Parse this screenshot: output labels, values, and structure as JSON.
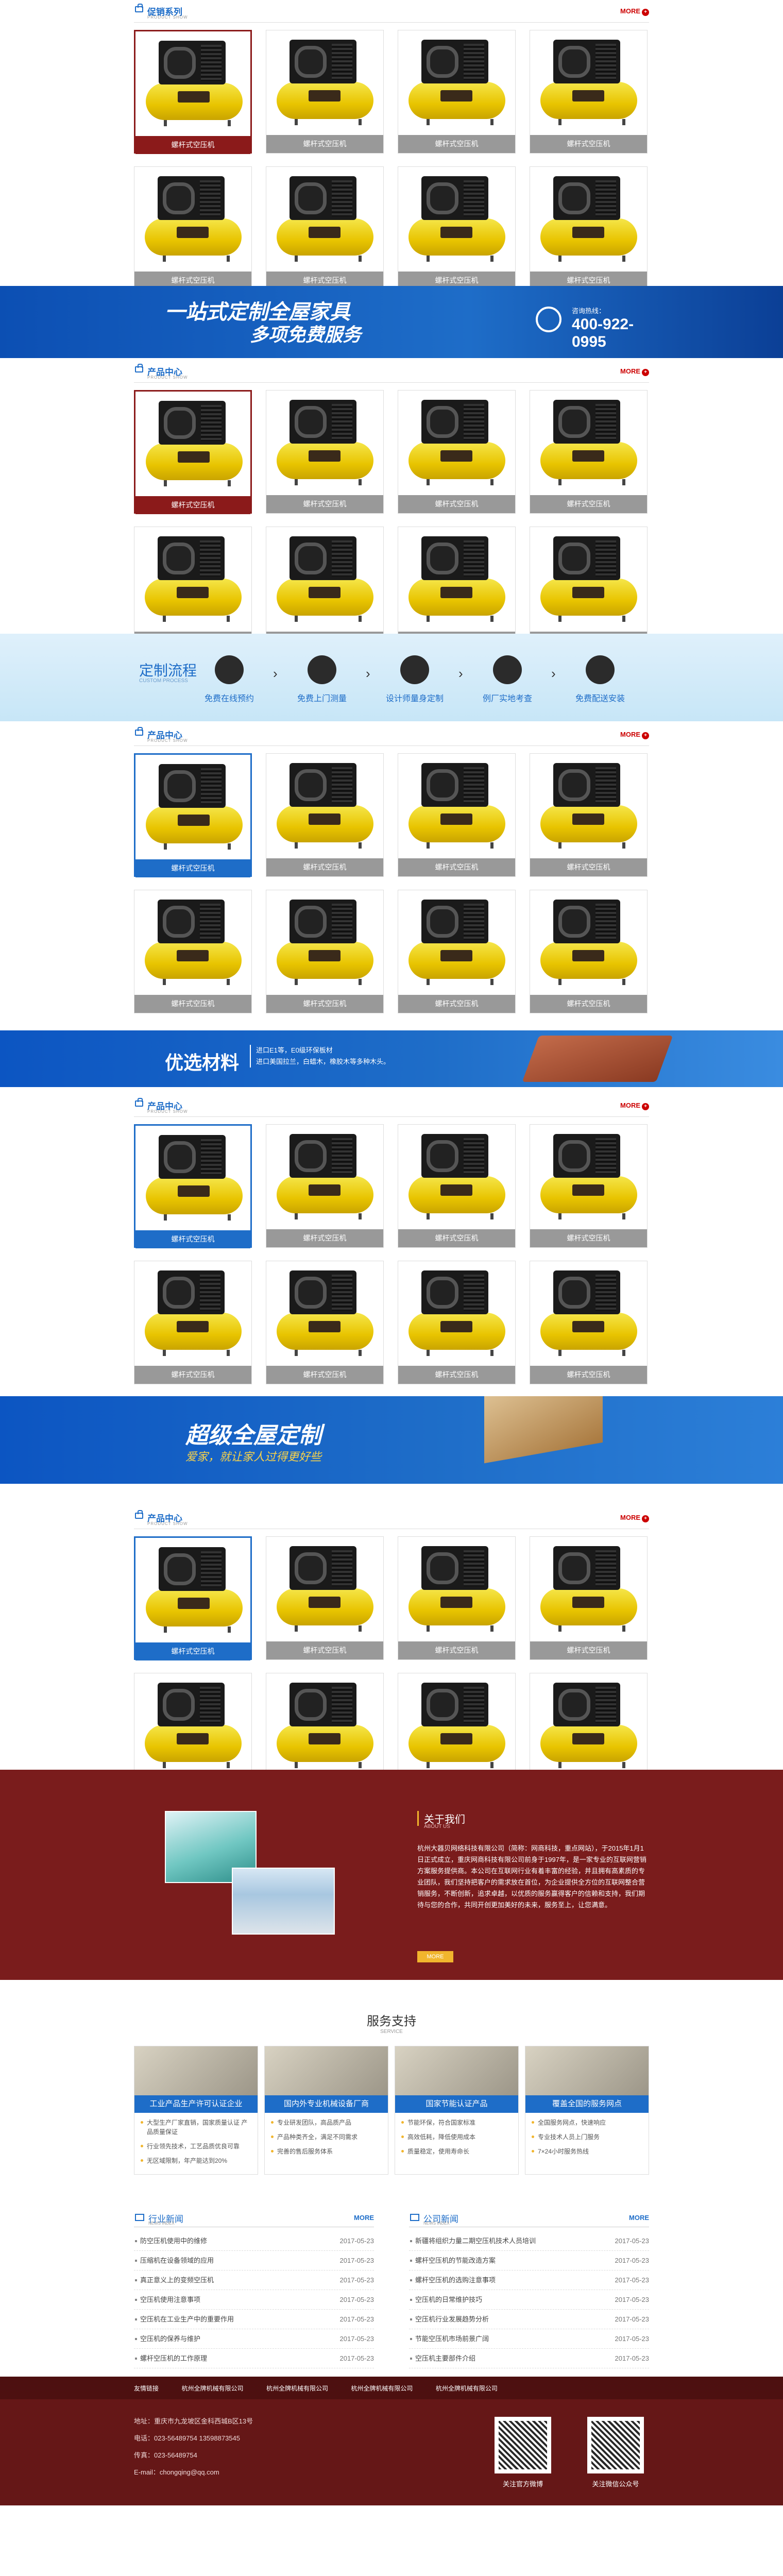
{
  "sections": [
    {
      "title": "促销系列",
      "en": "PRODUCT SHOW",
      "more": "MORE",
      "highlight": "red"
    },
    {
      "title": "产品中心",
      "en": "PRODUCT SHOW",
      "more": "MORE",
      "highlight": "red"
    },
    {
      "title": "产品中心",
      "en": "PRODUCT SHOW",
      "more": "MORE",
      "highlight": "blue"
    },
    {
      "title": "产品中心",
      "en": "PRODUCT SHOW",
      "more": "MORE",
      "highlight": "blue"
    },
    {
      "title": "产品中心",
      "en": "PRODUCT SHOW",
      "more": "MORE",
      "highlight": "blue"
    }
  ],
  "product_label": "螺杆式空压机",
  "banner1": {
    "line1": "一站式定制全屋家具",
    "line2": "多项免费服务",
    "phone_label": "咨询热线：",
    "phone": "400-922-0995"
  },
  "banner2": {
    "title": "定制流程",
    "en": "CUSTOM PROCESS",
    "steps": [
      "免费在线预约",
      "免费上门测量",
      "设计师量身定制",
      "例厂实地考查",
      "免费配送安装"
    ]
  },
  "banner3": {
    "title": "优选材料",
    "desc": "进口E1等，E0级环保板材\n进口美国拉兰，白蜡木，橡胶木等多种木头。"
  },
  "banner4": {
    "title": "超级全屋定制",
    "desc": "爱家，就让家人过得更好些"
  },
  "about": {
    "title": "关于我们",
    "en": "ABOUT US",
    "text": "杭州大器贝网络科技有限公司（简称：网商科技，重点网站），于2015年1月1日正式成立，重庆网商科技有限公司前身于1997年，是一家专业的互联网营销方案服务提供商。本公司在互联网行业有着丰富的经验，并且拥有高素质的专业团队，我们坚持把客户的需求放在首位，为企业提供全方位的互联网整合营销服务，不断创新，追求卓越，以优质的服务赢得客户的信赖和支持，我们期待与您的合作，共同开创更加美好的未来，服务至上，让您满意。",
    "more": "MORE"
  },
  "service": {
    "title": "服务支持",
    "en": "SERVICE",
    "cards": [
      {
        "head": "工业产品生产许可认证企业",
        "items": [
          "大型生产厂家直销，国家质量认证 产品质量保证",
          "行业领先技术，工艺品质优良可靠",
          "无区域限制，年产能达到20%"
        ]
      },
      {
        "head": "国内外专业机械设备厂商",
        "items": [
          "专业研发团队，高品质产品",
          "产品种类齐全，满足不同需求",
          "完善的售后服务体系"
        ]
      },
      {
        "head": "国家节能认证产品",
        "items": [
          "节能环保，符合国家标准",
          "高效低耗，降低使用成本",
          "质量稳定，使用寿命长"
        ]
      },
      {
        "head": "覆盖全国的服务网点",
        "items": [
          "全国服务网点，快速响应",
          "专业技术人员上门服务",
          "7×24小时服务热线"
        ]
      }
    ]
  },
  "news": [
    {
      "title": "行业新闻",
      "en": "NEWS INDEX",
      "more": "MORE",
      "items": [
        {
          "t": "防空压机使用中的维修",
          "d": "2017-05-23"
        },
        {
          "t": "压缩机在设备领域的应用",
          "d": "2017-05-23"
        },
        {
          "t": "真正意义上的变频空压机",
          "d": "2017-05-23"
        },
        {
          "t": "空压机使用注意事项",
          "d": "2017-05-23"
        },
        {
          "t": "空压机在工业生产中的重要作用",
          "d": "2017-05-23"
        },
        {
          "t": "空压机的保养与维护",
          "d": "2017-05-23"
        },
        {
          "t": "螺杆空压机的工作原理",
          "d": "2017-05-23"
        }
      ]
    },
    {
      "title": "公司新闻",
      "en": "NEWS INDEX",
      "more": "MORE",
      "items": [
        {
          "t": "新疆将组织力量二期空压机技术人员培训",
          "d": "2017-05-23"
        },
        {
          "t": "螺杆空压机的节能改造方案",
          "d": "2017-05-23"
        },
        {
          "t": "螺杆空压机的选购注意事项",
          "d": "2017-05-23"
        },
        {
          "t": "空压机的日常维护技巧",
          "d": "2017-05-23"
        },
        {
          "t": "空压机行业发展趋势分析",
          "d": "2017-05-23"
        },
        {
          "t": "节能空压机市场前景广阔",
          "d": "2017-05-23"
        },
        {
          "t": "空压机主要部件介绍",
          "d": "2017-05-23"
        }
      ]
    }
  ],
  "footer": {
    "links": [
      "友情链接",
      "杭州全牌机械有限公司",
      "杭州全牌机械有限公司",
      "杭州全牌机械有限公司",
      "杭州全牌机械有限公司"
    ],
    "lines": [
      "地址：重庆市九龙坡区金科西城B区13号",
      "电话：023-56489754  13598873545",
      "传真：023-56489754",
      "E-mail：chongqing@qq.com"
    ],
    "qr": [
      "关注官方微博",
      "关注微信公众号"
    ]
  }
}
